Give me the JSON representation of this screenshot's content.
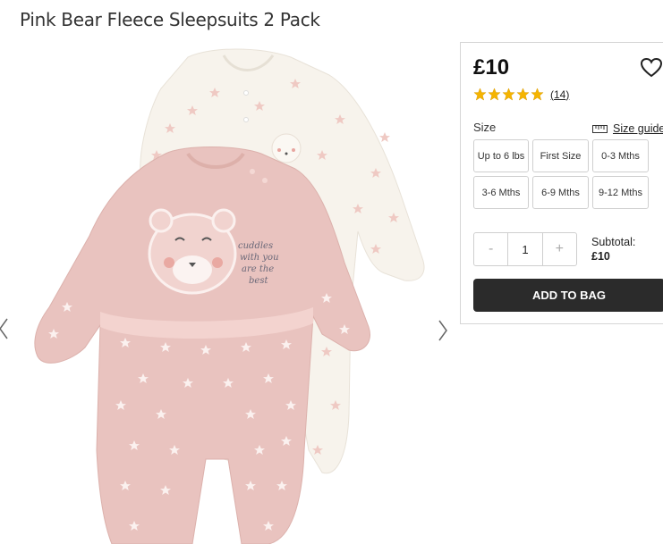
{
  "product": {
    "title": "Pink Bear Fleece Sleepsuits 2 Pack",
    "image_alt": "Pink and white bear star print fleece sleepsuits",
    "embroidery_text": [
      "cuddles",
      "with you",
      "are the",
      "best"
    ]
  },
  "price": "£10",
  "rating": {
    "stars": 5,
    "count": "14"
  },
  "size": {
    "label": "Size",
    "guide_label": "Size guide",
    "options": [
      "Up to 6 lbs",
      "First Size",
      "0-3 Mths",
      "3-6 Mths",
      "6-9 Mths",
      "9-12 Mths"
    ]
  },
  "quantity": {
    "minus": "-",
    "value": "1",
    "plus": "+"
  },
  "subtotal": {
    "label": "Subtotal:",
    "amount": "£10"
  },
  "add_to_bag_label": "ADD TO BAG",
  "colors": {
    "pink": "#e9c3bf",
    "cream": "#f7f3ec",
    "star_gold": "#f5b400",
    "button_dark": "#2b2b2b"
  },
  "icons": {
    "wishlist": "heart-icon",
    "rating": "star-icon",
    "size_guide": "ruler-icon",
    "prev": "chevron-left-icon",
    "next": "chevron-right-icon"
  }
}
